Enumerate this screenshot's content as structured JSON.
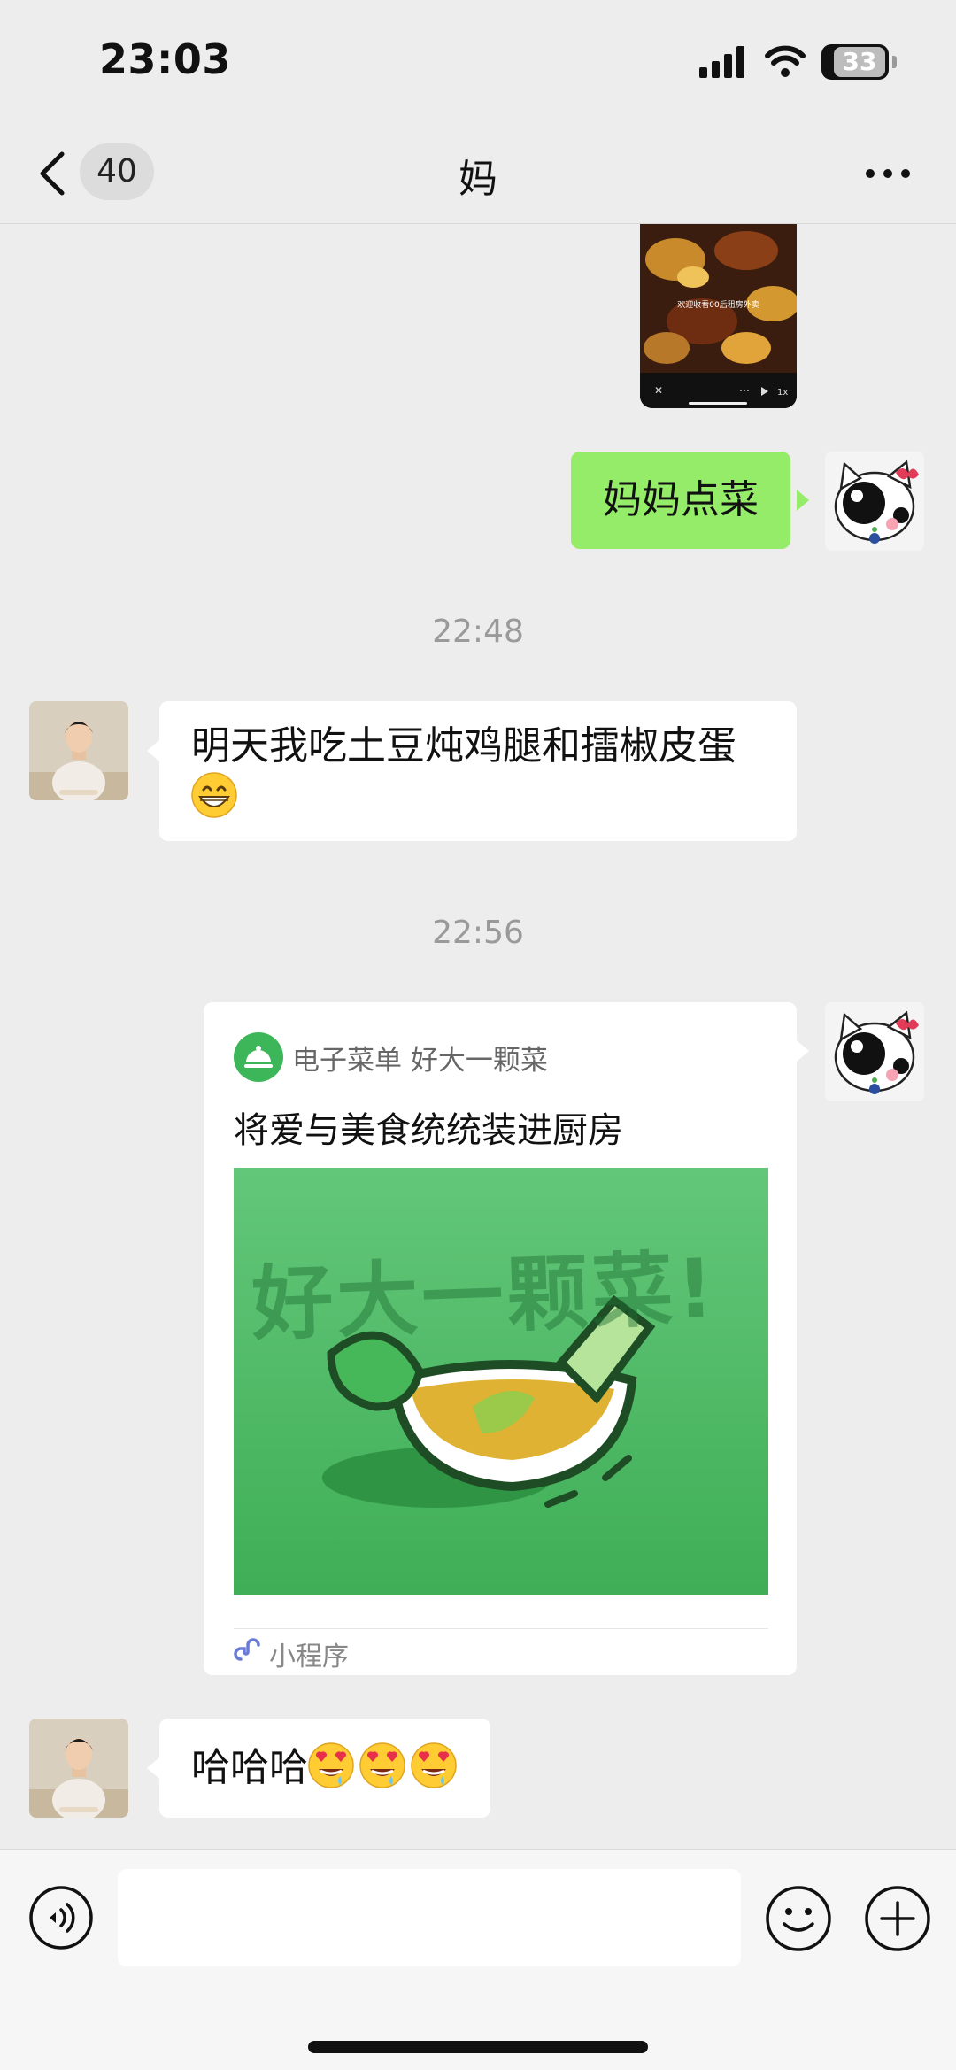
{
  "status_bar": {
    "time": "23:03",
    "battery": "33"
  },
  "nav": {
    "back_badge": "40",
    "title": "妈",
    "more_icon": "more-icon"
  },
  "messages": [
    {
      "type": "video",
      "sender": "me",
      "overlay_text": "欢迎收看00后租房外卖"
    },
    {
      "type": "text",
      "sender": "me",
      "text": "妈妈点菜"
    },
    {
      "type": "timestamp",
      "text": "22:48"
    },
    {
      "type": "text",
      "sender": "mom",
      "text": "明天我吃土豆炖鸡腿和擂椒皮蛋",
      "emoji": [
        "grinning-face-emoji"
      ]
    },
    {
      "type": "timestamp",
      "text": "22:56"
    },
    {
      "type": "mini_program",
      "sender": "me",
      "app": "电子菜单 好大一颗菜",
      "title": "将爱与美食统统装进厨房",
      "image_text": "好大一颗菜!",
      "footer": "小程序"
    },
    {
      "type": "text",
      "sender": "mom",
      "text": "哈哈哈",
      "emoji": [
        "drooling-heart-eyes-emoji",
        "drooling-heart-eyes-emoji",
        "drooling-heart-eyes-emoji"
      ]
    }
  ],
  "input_bar": {
    "text_value": ""
  },
  "colors": {
    "green_bubble": "#95ec69",
    "background": "#ededed",
    "card_green": "#4cbf63"
  }
}
